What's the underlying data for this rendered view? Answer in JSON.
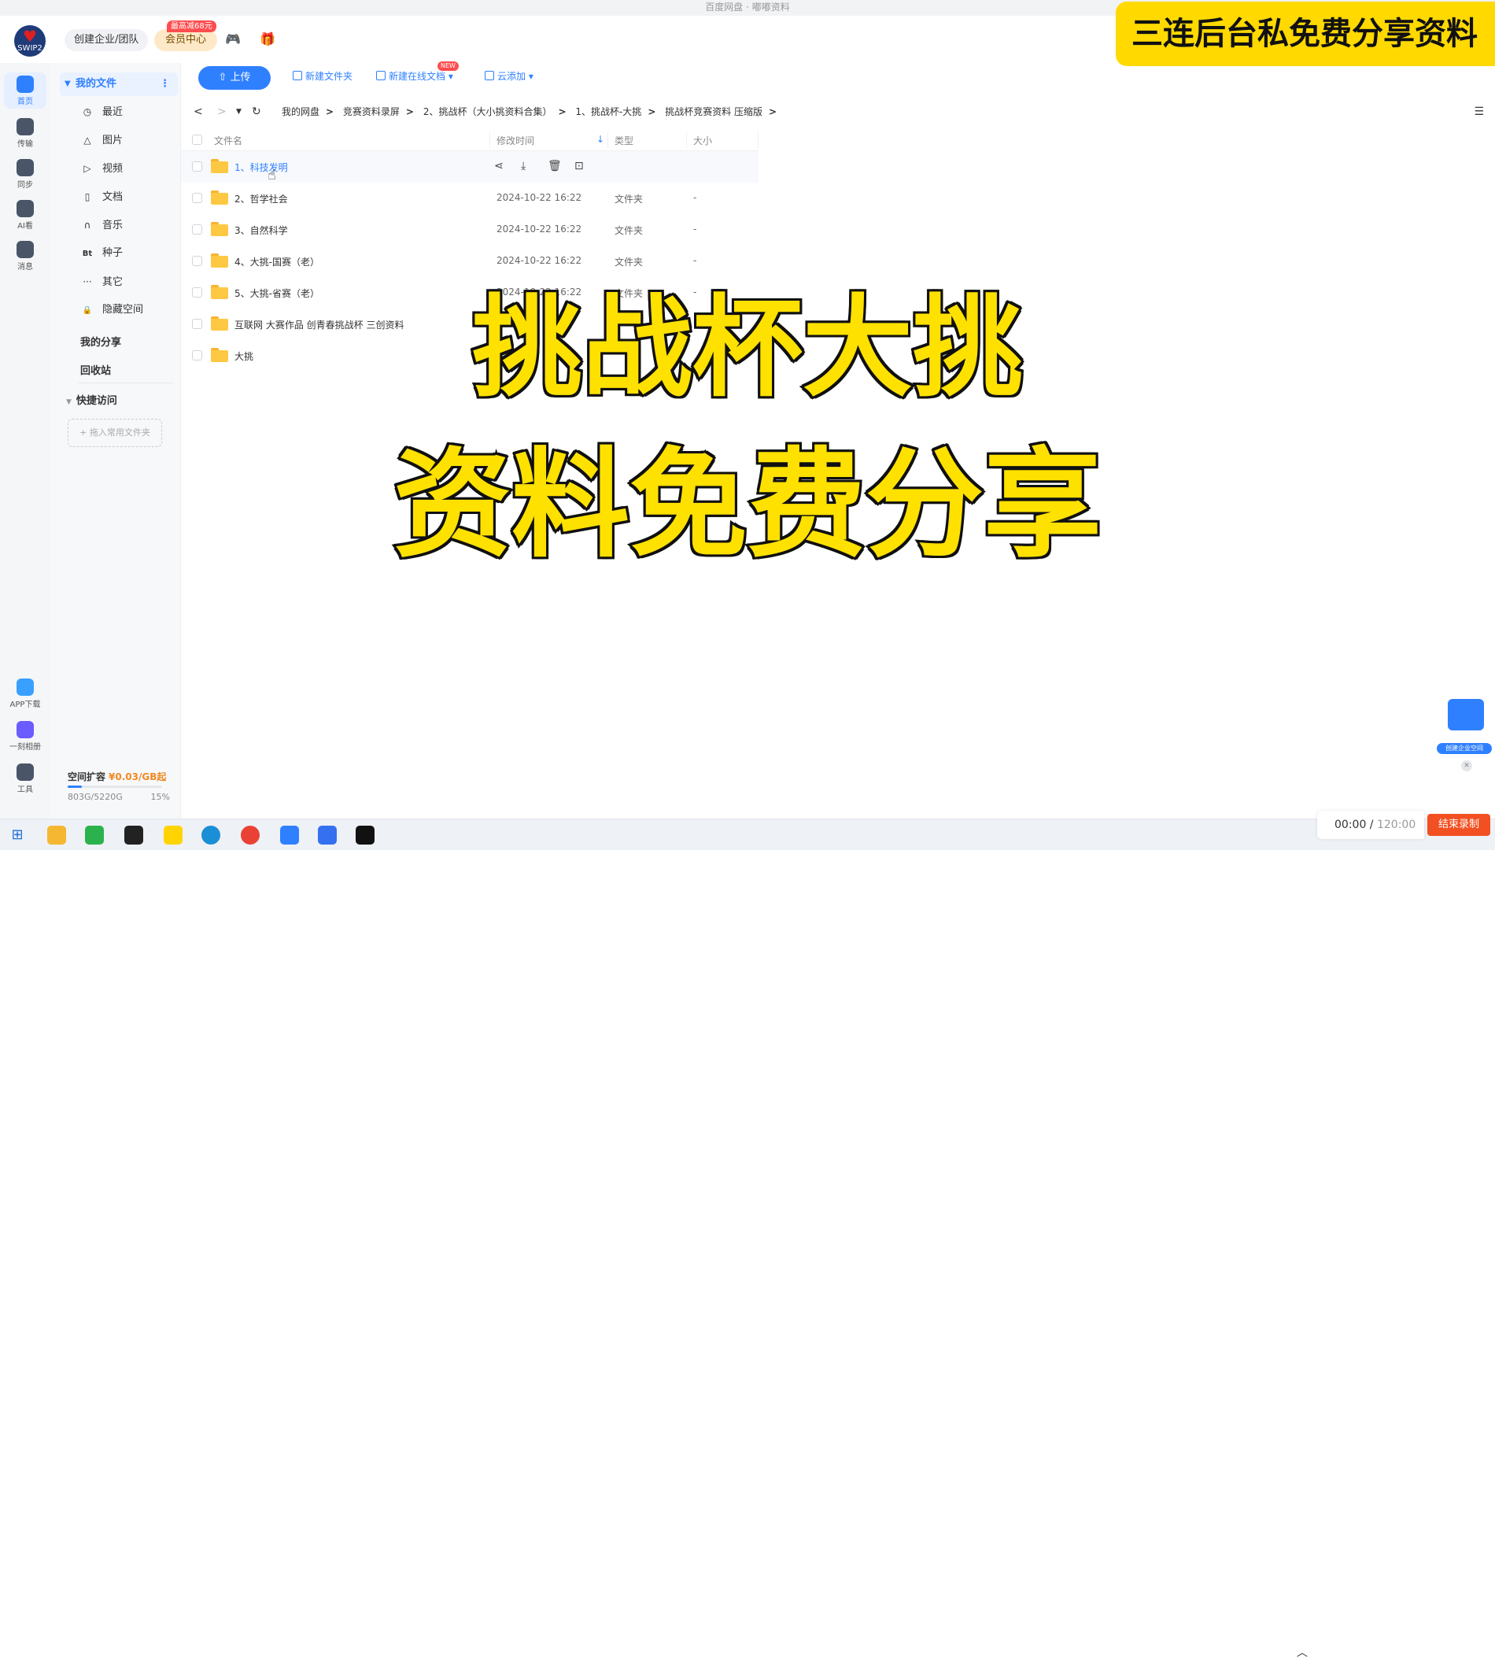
{
  "window": {
    "title": "百度网盘 · 嘟嘟资料"
  },
  "header": {
    "avatar_text": "SWIP2",
    "team_button": "创建企业/团队",
    "vip_button": "会员中心",
    "vip_tag": "最高减68元",
    "promo_banner": "三连后台私免费分享资料"
  },
  "rail": {
    "items": [
      {
        "label": "首页",
        "icon": "home-icon"
      },
      {
        "label": "传输",
        "icon": "transfer-icon"
      },
      {
        "label": "同步",
        "icon": "sync-icon"
      },
      {
        "label": "AI看",
        "icon": "ai-icon"
      },
      {
        "label": "消息",
        "icon": "message-icon"
      }
    ],
    "bottom": [
      {
        "label": "APP下载",
        "icon": "phone-icon"
      },
      {
        "label": "一刻相册",
        "icon": "album-icon"
      },
      {
        "label": "工具",
        "icon": "tools-icon"
      }
    ]
  },
  "sidebar": {
    "my_files": "我的文件",
    "items": [
      {
        "label": "最近",
        "icon": "clock-icon",
        "glyph": "◷"
      },
      {
        "label": "图片",
        "icon": "image-icon",
        "glyph": "△"
      },
      {
        "label": "视频",
        "icon": "video-icon",
        "glyph": "▷"
      },
      {
        "label": "文档",
        "icon": "document-icon",
        "glyph": "▯"
      },
      {
        "label": "音乐",
        "icon": "headphones-icon",
        "glyph": "∩"
      },
      {
        "label": "种子",
        "icon": "bt-icon",
        "glyph": "Bt"
      },
      {
        "label": "其它",
        "icon": "more-icon",
        "glyph": "···"
      },
      {
        "label": "隐藏空间",
        "icon": "lock-icon",
        "glyph": "🔒"
      }
    ],
    "my_share": "我的分享",
    "recycle": "回收站",
    "quick_access": "快捷访问",
    "drop_hint": "+ 拖入常用文件夹",
    "storage_title": "空间扩容",
    "storage_price": "¥0.03/GB起",
    "storage_used": "803G/5220G",
    "storage_pct": "15%",
    "storage_fraction": 0.15
  },
  "toolbar": {
    "upload": "上传",
    "new_folder": "新建文件夹",
    "new_doc": "新建在线文档",
    "new_badge": "NEW",
    "cloud_add": "云添加"
  },
  "breadcrumb": [
    "我的网盘",
    "竞赛资料录屏",
    "2、挑战杯（大小挑资料合集）",
    "1、挑战杯-大挑",
    "挑战杯竞赛资料 压缩版"
  ],
  "table": {
    "headers": {
      "name": "文件名",
      "modified": "修改时间",
      "type": "类型",
      "size": "大小"
    },
    "rows": [
      {
        "name": "1、科技发明",
        "date": "",
        "type": "",
        "size": ""
      },
      {
        "name": "2、哲学社会",
        "date": "2024-10-22 16:22",
        "type": "文件夹",
        "size": "-"
      },
      {
        "name": "3、自然科学",
        "date": "2024-10-22 16:22",
        "type": "文件夹",
        "size": "-"
      },
      {
        "name": "4、大挑-国赛（老）",
        "date": "2024-10-22 16:22",
        "type": "文件夹",
        "size": "-"
      },
      {
        "name": "5、大挑-省赛（老）",
        "date": "2024-10-22 16:22",
        "type": "文件夹",
        "size": "-"
      },
      {
        "name": "互联网 大赛作品 创青春挑战杯 三创资料",
        "date": "",
        "type": "",
        "size": ""
      },
      {
        "name": "大挑",
        "date": "",
        "type": "",
        "size": ""
      }
    ]
  },
  "overlay": {
    "line1": "挑战杯大挑",
    "line2": "资料免费分享"
  },
  "widget": {
    "label": "创建企业空间"
  },
  "recorder": {
    "elapsed": "00:00",
    "total": "120:00",
    "stop": "结束录制"
  },
  "colors": {
    "accent": "#2f80ff",
    "promo": "#ffd900",
    "caption": "#ffe100",
    "stop": "#f25022"
  }
}
